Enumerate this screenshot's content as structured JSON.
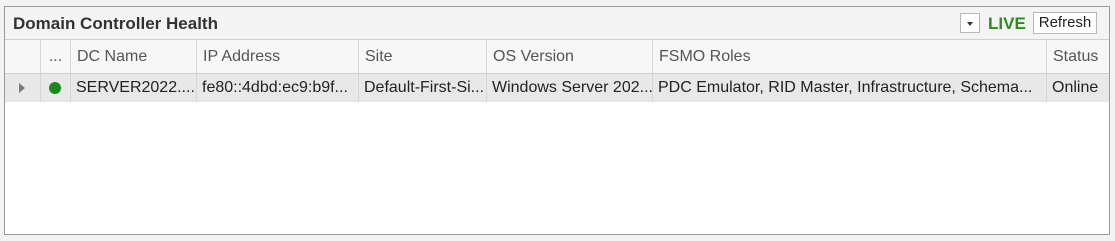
{
  "panel": {
    "title": "Domain Controller Health",
    "live_label": "LIVE",
    "refresh_label": "Refresh",
    "dropdown_icon": "chevron-down-icon"
  },
  "colors": {
    "live": "#2e8b1c",
    "status_online": "#1a8a1a",
    "selected_row": "#e8e8e8"
  },
  "grid": {
    "columns": [
      "",
      "...",
      "DC Name",
      "IP Address",
      "Site",
      "OS Version",
      "FSMO Roles",
      "Status"
    ],
    "rows": [
      {
        "dc_name": "SERVER2022....",
        "ip_address": "fe80::4dbd:ec9:b9f...",
        "site": "Default-First-Si...",
        "os_version": "Windows Server 202...",
        "fsmo_roles": "PDC Emulator, RID Master, Infrastructure, Schema...",
        "status": "Online",
        "indicator_icon": "green-status-dot-icon"
      }
    ]
  }
}
